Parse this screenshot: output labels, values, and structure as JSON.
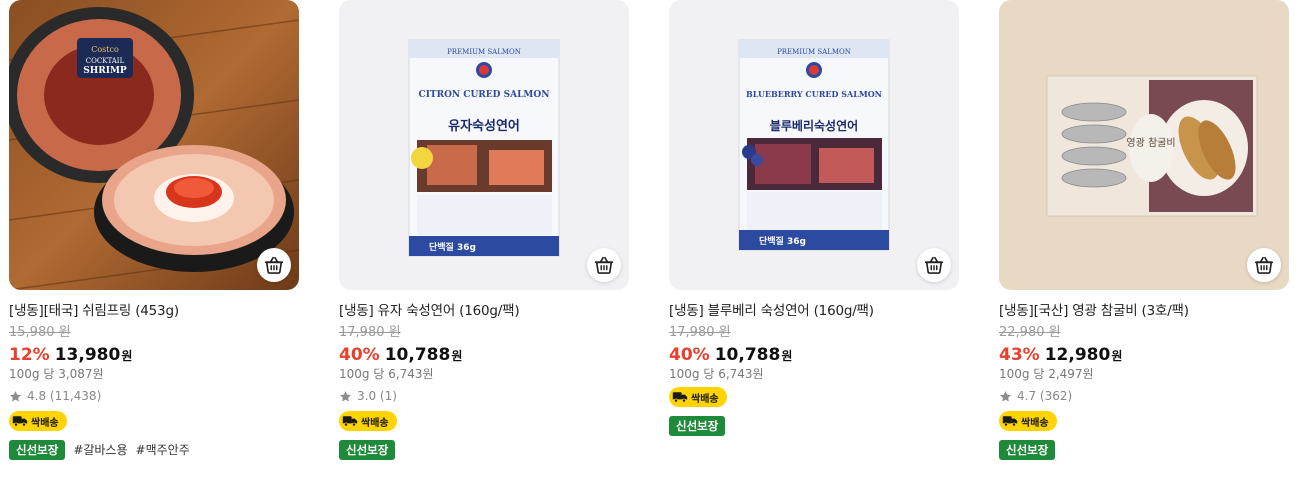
{
  "products": [
    {
      "title": "[냉동][태국] 쉬림프링 (453g)",
      "original_price": "15,980 원",
      "discount_rate": "12%",
      "price": "13,980",
      "currency": "원",
      "unit_price": "100g 당 3,087원",
      "rating": "4.8 (11,438)",
      "fast_delivery": "싹배송",
      "fresh_guarantee": "신선보장",
      "hashtags": [
        "#갈바스용",
        "#맥주안주"
      ],
      "image_text": {
        "brand": "Costco",
        "line1": "COCKTAIL",
        "line2": "SHRIMP"
      }
    },
    {
      "title": "[냉동] 유자 숙성연어 (160g/팩)",
      "original_price": "17,980 원",
      "discount_rate": "40%",
      "price": "10,788",
      "currency": "원",
      "unit_price": "100g 당 6,743원",
      "rating": "3.0 (1)",
      "fast_delivery": "싹배송",
      "fresh_guarantee": "신선보장",
      "hashtags": [],
      "image_text": {
        "top": "PREMIUM SALMON",
        "en": "CITRON CURED SALMON",
        "ko": "유자숙성연어",
        "protein": "단백질 36g"
      }
    },
    {
      "title": "[냉동] 블루베리 숙성연어 (160g/팩)",
      "original_price": "17,980 원",
      "discount_rate": "40%",
      "price": "10,788",
      "currency": "원",
      "unit_price": "100g 당 6,743원",
      "rating": null,
      "fast_delivery": "싹배송",
      "fresh_guarantee": "신선보장",
      "hashtags": [],
      "image_text": {
        "top": "PREMIUM SALMON",
        "en": "BLUEBERRY CURED SALMON",
        "ko": "블루베리숙성연어",
        "protein": "단백질 36g"
      }
    },
    {
      "title": "[냉동][국산] 영광 참굴비 (3호/팩)",
      "original_price": "22,980 원",
      "discount_rate": "43%",
      "price": "12,980",
      "currency": "원",
      "unit_price": "100g 당 2,497원",
      "rating": "4.7 (362)",
      "fast_delivery": "싹배송",
      "fresh_guarantee": "신선보장",
      "hashtags": [],
      "image_text": {
        "ko": "영광 참굴비"
      }
    }
  ],
  "colors": {
    "discount": "#e8402c",
    "fresh_badge": "#1e8a3a",
    "fast_badge": "#ffd400",
    "salmon_pack": "#2c4aa0"
  },
  "icons": {
    "cart": "basket-icon",
    "star": "star-icon",
    "delivery": "truck-icon"
  }
}
